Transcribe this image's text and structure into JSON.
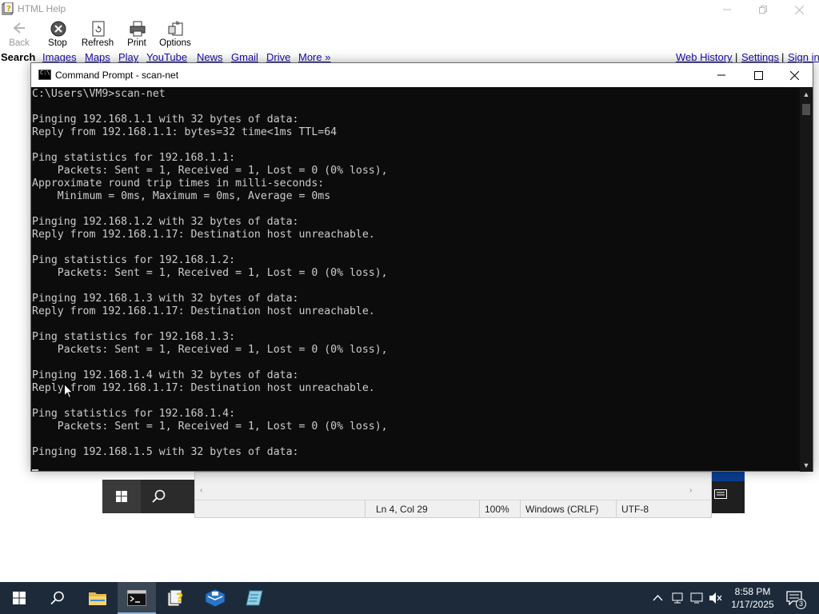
{
  "help_window": {
    "title": "HTML Help",
    "toolbar": [
      {
        "id": "back",
        "label": "Back",
        "icon": "back-arrow-icon",
        "enabled": false
      },
      {
        "id": "stop",
        "label": "Stop",
        "icon": "stop-icon",
        "enabled": true
      },
      {
        "id": "refresh",
        "label": "Refresh",
        "icon": "refresh-icon",
        "enabled": true
      },
      {
        "id": "print",
        "label": "Print",
        "icon": "print-icon",
        "enabled": true
      },
      {
        "id": "options",
        "label": "Options",
        "icon": "options-icon",
        "enabled": true
      }
    ],
    "nav": {
      "search": "Search",
      "links": [
        "Images",
        "Maps",
        "Play",
        "YouTube",
        "News",
        "Gmail",
        "Drive",
        "More »"
      ],
      "right_links": [
        "Web History",
        "Settings",
        "Sign in"
      ],
      "separator": "|"
    }
  },
  "cmd": {
    "title": "Command Prompt - scan-net",
    "lines": [
      "C:\\Users\\VM9>scan-net",
      "",
      "Pinging 192.168.1.1 with 32 bytes of data:",
      "Reply from 192.168.1.1: bytes=32 time<1ms TTL=64",
      "",
      "Ping statistics for 192.168.1.1:",
      "    Packets: Sent = 1, Received = 1, Lost = 0 (0% loss),",
      "Approximate round trip times in milli-seconds:",
      "    Minimum = 0ms, Maximum = 0ms, Average = 0ms",
      "",
      "Pinging 192.168.1.2 with 32 bytes of data:",
      "Reply from 192.168.1.17: Destination host unreachable.",
      "",
      "Ping statistics for 192.168.1.2:",
      "    Packets: Sent = 1, Received = 1, Lost = 0 (0% loss),",
      "",
      "Pinging 192.168.1.3 with 32 bytes of data:",
      "Reply from 192.168.1.17: Destination host unreachable.",
      "",
      "Ping statistics for 192.168.1.3:",
      "    Packets: Sent = 1, Received = 1, Lost = 0 (0% loss),",
      "",
      "Pinging 192.168.1.4 with 32 bytes of data:",
      "Reply from 192.168.1.17: Destination host unreachable.",
      "",
      "Ping statistics for 192.168.1.4:",
      "    Packets: Sent = 1, Received = 1, Lost = 0 (0% loss),",
      "",
      "Pinging 192.168.1.5 with 32 bytes of data:"
    ]
  },
  "notepad": {
    "position": "Ln 4, Col 29",
    "zoom": "100%",
    "line_ending": "Windows (CRLF)",
    "encoding": "UTF-8"
  },
  "taskbar": {
    "apps": [
      "start-icon",
      "search-icon",
      "file-explorer-icon",
      "command-prompt-icon",
      "html-help-icon",
      "virtualbox-icon",
      "notepad-icon"
    ],
    "active_app": "command-prompt-icon",
    "time": "8:58 PM",
    "date": "1/17/2025",
    "notifications": "3"
  }
}
